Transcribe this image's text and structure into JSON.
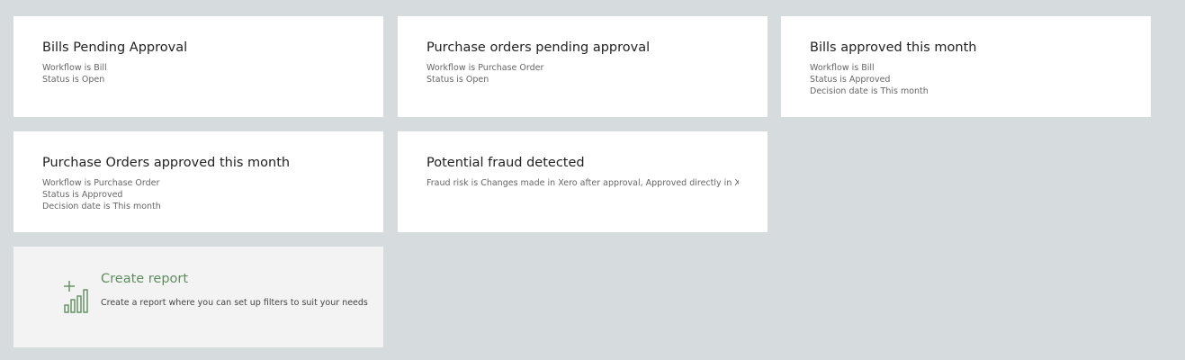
{
  "reports": [
    {
      "title": "Bills Pending Approval",
      "filters": [
        "Workflow is Bill",
        "Status is Open"
      ]
    },
    {
      "title": "Purchase orders pending approval",
      "filters": [
        "Workflow is Purchase Order",
        "Status is Open"
      ]
    },
    {
      "title": "Bills approved this month",
      "filters": [
        "Workflow is Bill",
        "Status is Approved",
        "Decision date is This month"
      ]
    },
    {
      "title": "Purchase Orders approved this month",
      "filters": [
        "Workflow is Purchase Order",
        "Status is Approved",
        "Decision date is This month"
      ]
    },
    {
      "title": "Potential fraud detected",
      "filters": [
        "Fraud risk is Changes made in Xero after approval, Approved directly in Xero, ."
      ]
    }
  ],
  "create_report": {
    "title": "Create report",
    "description": "Create a report where you can set up filters to suit your needs",
    "icon": "bar-chart-plus-icon",
    "accent_color": "#5e8e5e"
  },
  "colors": {
    "page_background": "#d6dcde",
    "card_background": "#ffffff",
    "create_card_background": "#f3f3f3"
  }
}
